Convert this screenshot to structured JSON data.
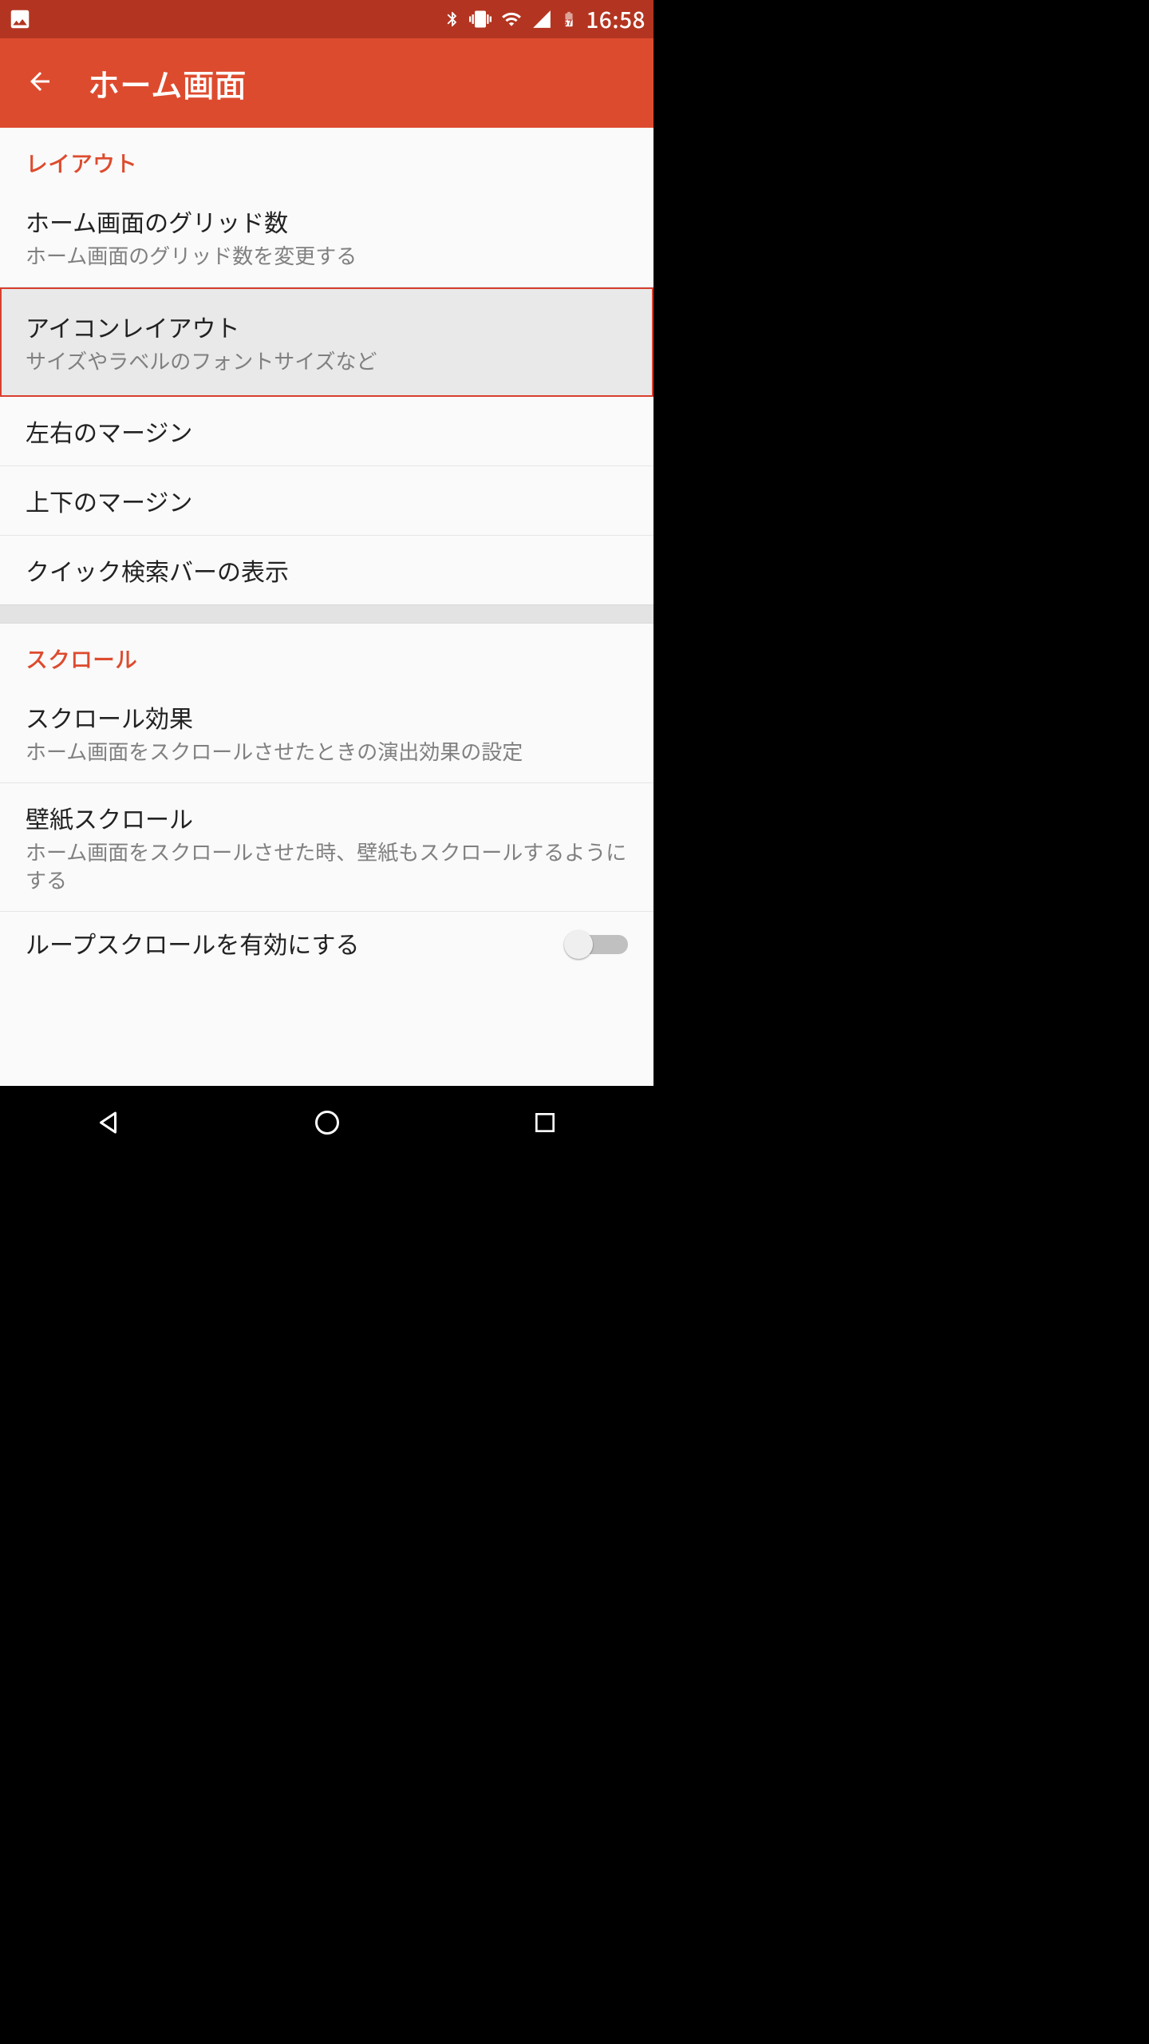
{
  "status": {
    "time": "16:58",
    "battery_text": "57"
  },
  "appbar": {
    "title": "ホーム画面"
  },
  "sections": {
    "layout": {
      "header": "レイアウト",
      "items": {
        "grid": {
          "title": "ホーム画面のグリッド数",
          "sub": "ホーム画面のグリッド数を変更する"
        },
        "icon_layout": {
          "title": "アイコンレイアウト",
          "sub": "サイズやラベルのフォントサイズなど"
        },
        "lr_margin": {
          "title": "左右のマージン"
        },
        "tb_margin": {
          "title": "上下のマージン"
        },
        "qsb": {
          "title": "クイック検索バーの表示"
        }
      }
    },
    "scroll": {
      "header": "スクロール",
      "items": {
        "effect": {
          "title": "スクロール効果",
          "sub": "ホーム画面をスクロールさせたときの演出効果の設定"
        },
        "wallpaper": {
          "title": "壁紙スクロール",
          "sub": "ホーム画面をスクロールさせた時、壁紙もスクロールするようにする"
        },
        "loop": {
          "title": "ループスクロールを有効にする"
        }
      }
    }
  }
}
